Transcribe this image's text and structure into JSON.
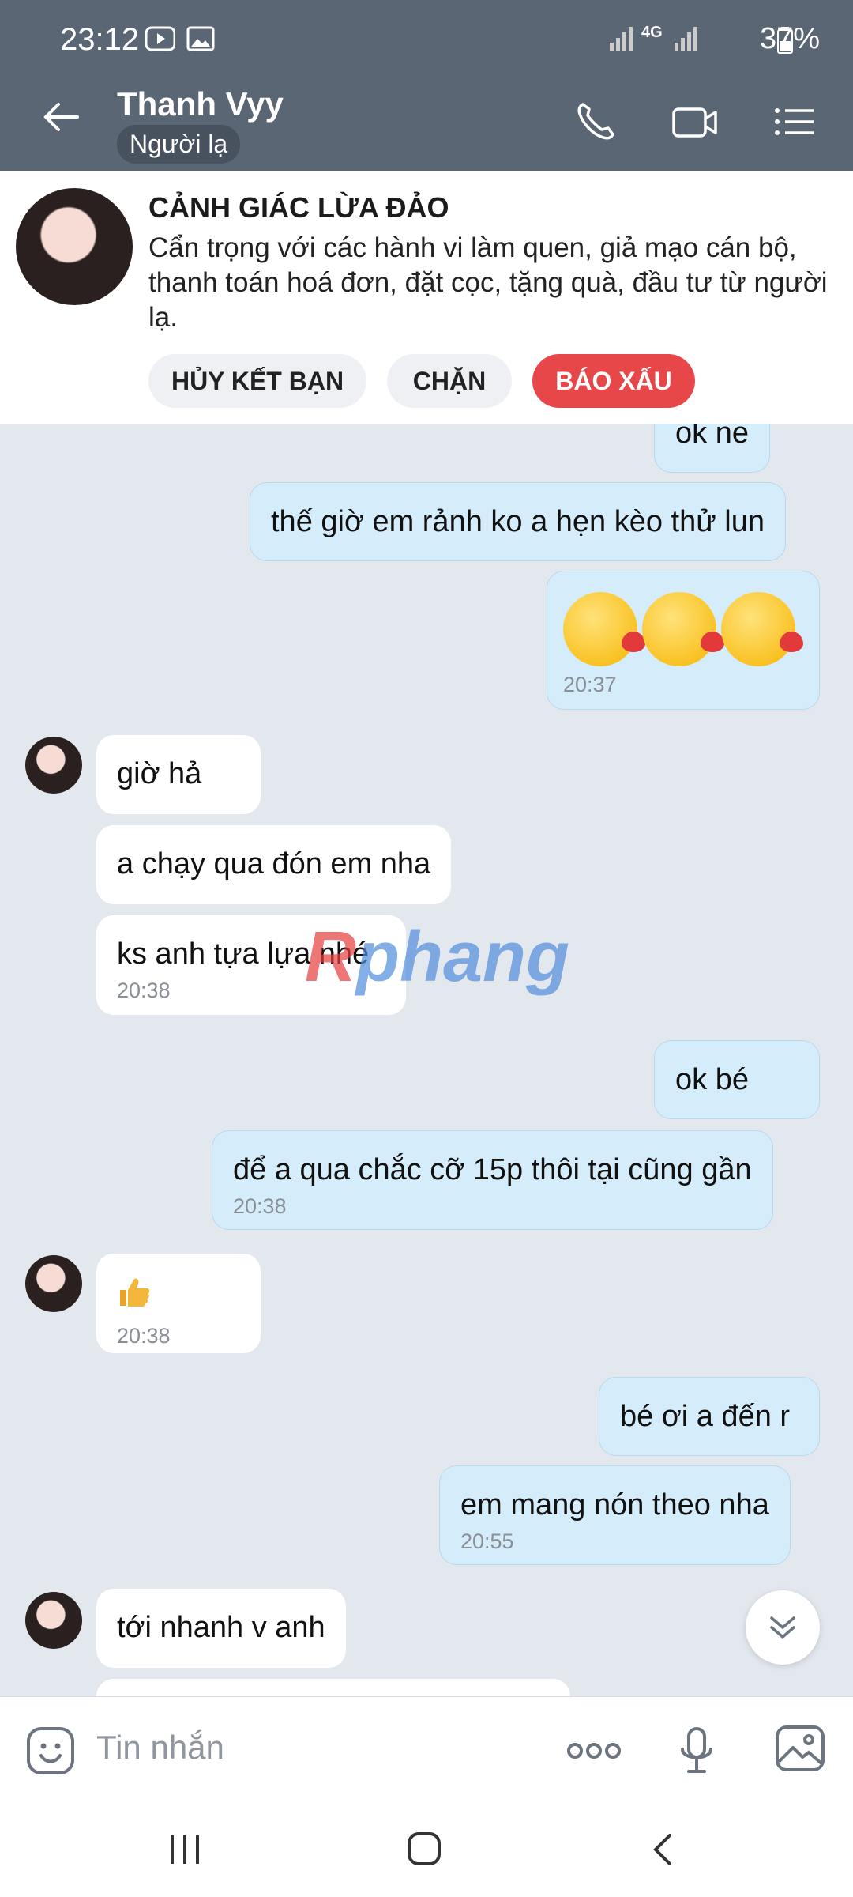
{
  "status": {
    "time": "23:12",
    "network": "4G",
    "battery": "37%"
  },
  "header": {
    "name": "Thanh Vyy",
    "tag": "Người lạ"
  },
  "warning": {
    "title": "CẢNH GIÁC LỪA ĐẢO",
    "text": "Cẩn trọng với các hành vi làm quen, giả mạo cán bộ, thanh toán hoá đơn, đặt cọc, tặng quà, đầu tư từ người lạ.",
    "buttons": {
      "unfriend": "HỦY KẾT BẠN",
      "block": "CHẶN",
      "report": "BÁO XẤU"
    }
  },
  "messages": [
    {
      "from": "me",
      "text": "ok ne"
    },
    {
      "from": "me",
      "text": "thế giờ em rảnh ko a hẹn kèo thử lun"
    },
    {
      "from": "me",
      "emoji": "kissing-face-x3",
      "time": "20:37"
    },
    {
      "from": "them",
      "text": "giờ hả"
    },
    {
      "from": "them",
      "text": "a chạy qua đón em nha"
    },
    {
      "from": "them",
      "text": "ks anh tựa lựa nhé",
      "time": "20:38"
    },
    {
      "from": "me",
      "text": "ok bé"
    },
    {
      "from": "me",
      "text": "để a qua chắc cỡ 15p thôi tại cũng gần",
      "time": "20:38"
    },
    {
      "from": "them",
      "emoji": "thumbs-up",
      "time": "20:38"
    },
    {
      "from": "me",
      "text": "bé ơi a đến r"
    },
    {
      "from": "me",
      "text": "em mang nón theo nha",
      "time": "20:55"
    },
    {
      "from": "them",
      "text": "tới nhanh v anh"
    }
  ],
  "watermark": {
    "a": "R",
    "b": "phang"
  },
  "composer": {
    "placeholder": "Tin nhắn"
  },
  "colors": {
    "header": "#5b6675",
    "report": "#e8474a",
    "my_bubble": "#d5ecfb"
  }
}
